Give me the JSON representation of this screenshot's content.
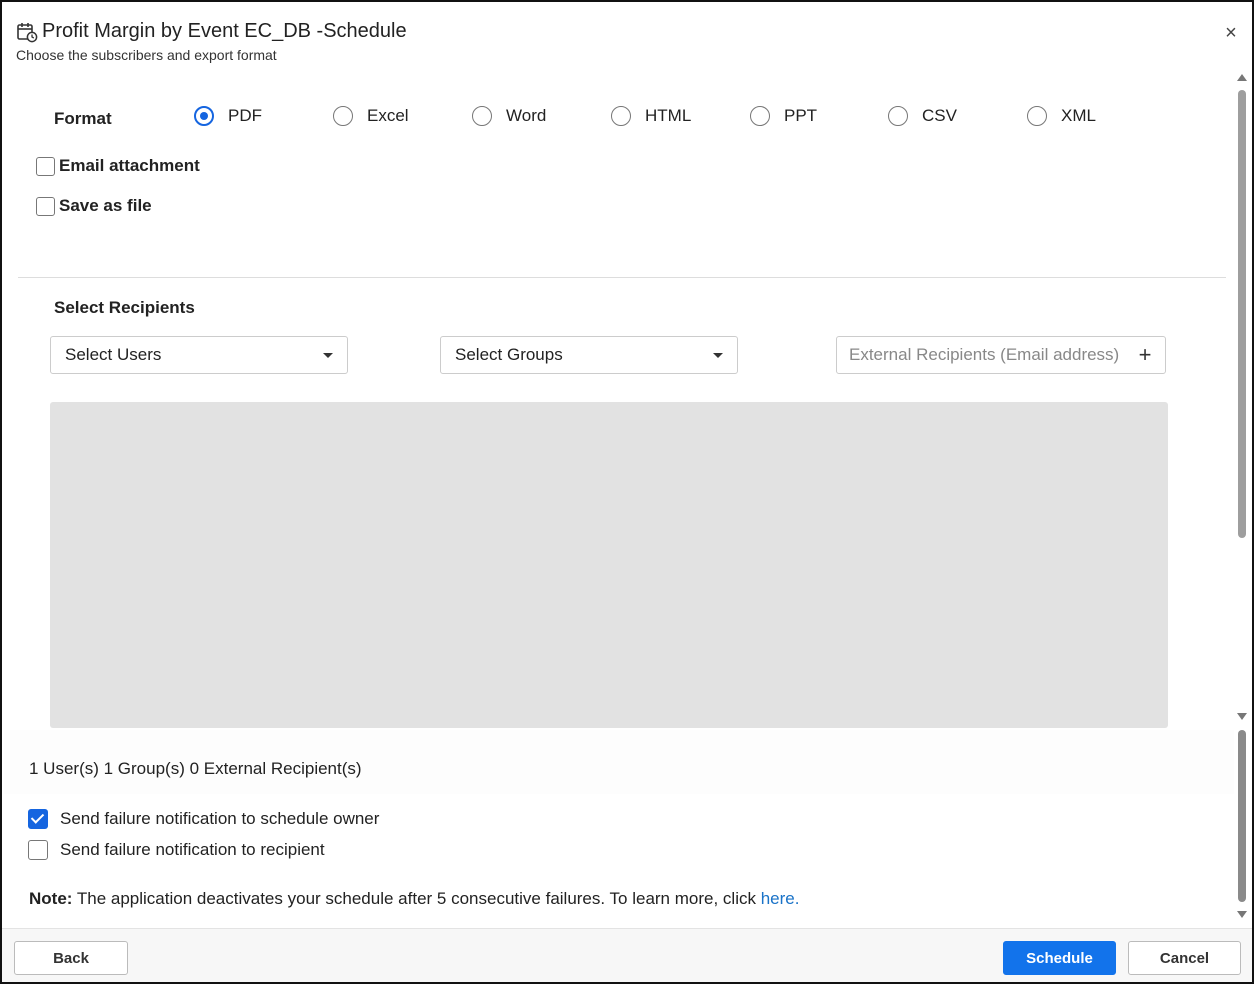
{
  "dialog": {
    "title": "Profit Margin by Event EC_DB -Schedule",
    "subtitle": "Choose the subscribers and export format",
    "close_icon": "×"
  },
  "format": {
    "label": "Format",
    "options": [
      "PDF",
      "Excel",
      "Word",
      "HTML",
      "PPT",
      "CSV",
      "XML"
    ],
    "selected": "PDF"
  },
  "delivery": {
    "email_attachment": {
      "label": "Email attachment",
      "checked": false
    },
    "save_as_file": {
      "label": "Save as file",
      "checked": false
    }
  },
  "recipients": {
    "label": "Select Recipients",
    "select_users": "Select Users",
    "select_groups": "Select Groups",
    "external_placeholder": "External Recipients (Email address)",
    "add_icon": "+",
    "summary": "1 User(s) 1 Group(s) 0 External Recipient(s)"
  },
  "notifications": {
    "owner": {
      "label": "Send failure notification to schedule owner",
      "checked": true
    },
    "recipient": {
      "label": "Send failure notification to recipient",
      "checked": false
    }
  },
  "note": {
    "prefix": "Note:",
    "text": " The application deactivates your schedule after 5 consecutive failures. To learn more, click ",
    "link": "here."
  },
  "footer": {
    "back": "Back",
    "schedule": "Schedule",
    "cancel": "Cancel"
  },
  "colors": {
    "accent": "#1273eb",
    "link": "#1a73c8"
  }
}
